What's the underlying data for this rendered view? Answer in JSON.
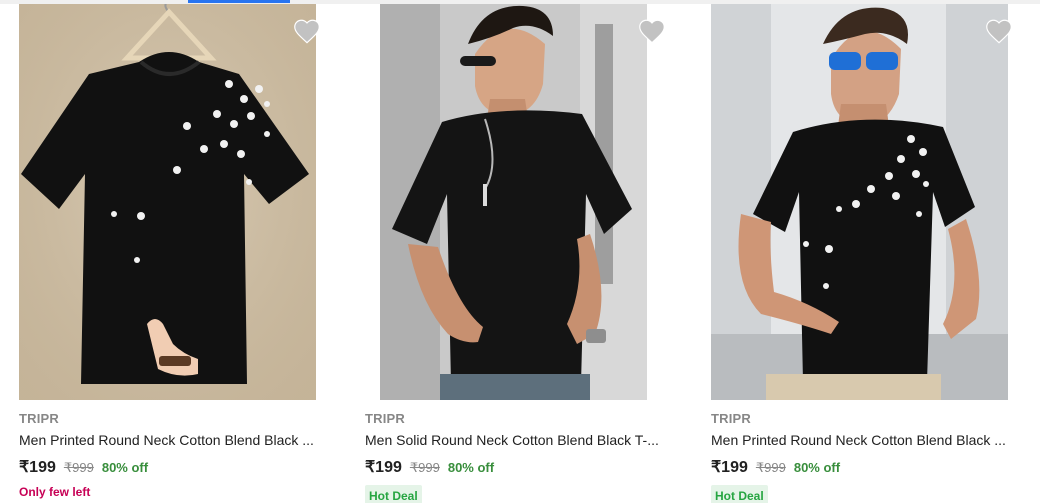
{
  "colors": {
    "accent": "#2874f0",
    "brand_text": "#878787",
    "discount": "#388e3c",
    "urgent": "#c70055",
    "deal_bg": "#e5f4e8",
    "deal_text": "#26a541",
    "wishlist": "#c2c2c2"
  },
  "products": [
    {
      "image": "black-printed-tshirt-on-hanger",
      "wishlist_icon": "heart-icon",
      "brand": "TRIPR",
      "title": "Men Printed Round Neck Cotton Blend Black ...",
      "price": "₹199",
      "mrp": "₹999",
      "discount": "80% off",
      "note": "Only few left"
    },
    {
      "image": "model-in-plain-black-tshirt",
      "wishlist_icon": "heart-icon",
      "brand": "TRIPR",
      "title": "Men Solid Round Neck Cotton Blend Black T-...",
      "price": "₹199",
      "mrp": "₹999",
      "discount": "80% off",
      "tag": "Hot Deal"
    },
    {
      "image": "model-in-black-printed-tshirt",
      "wishlist_icon": "heart-icon",
      "brand": "TRIPR",
      "title": "Men Printed Round Neck Cotton Blend Black ...",
      "price": "₹199",
      "mrp": "₹999",
      "discount": "80% off",
      "tag": "Hot Deal"
    }
  ]
}
